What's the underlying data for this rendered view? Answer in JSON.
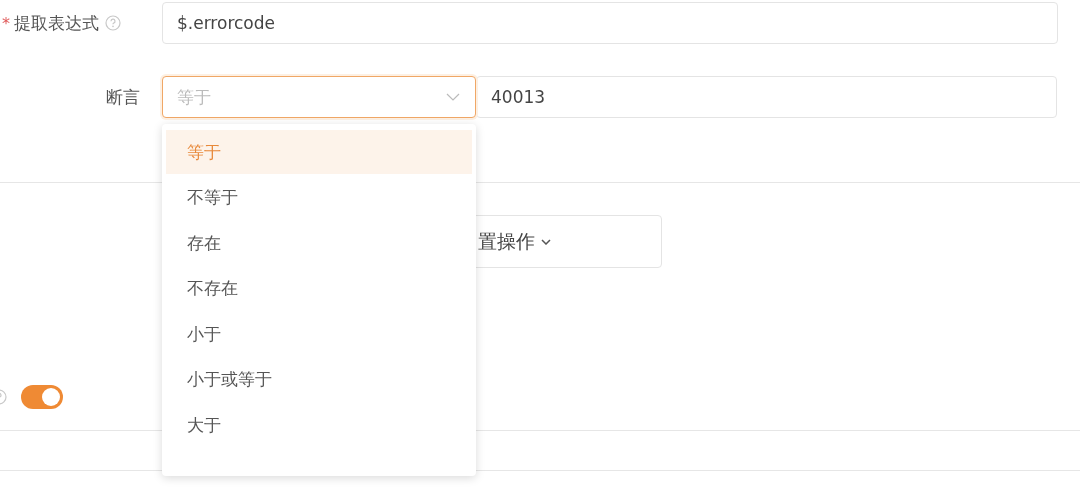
{
  "extract_field": {
    "required_mark": "*",
    "label": "提取表达式",
    "value": "$.errorcode"
  },
  "assert_field": {
    "label": "断言",
    "select": {
      "placeholder": "等于",
      "open": true
    },
    "value": "40013"
  },
  "dropdown": {
    "options": [
      {
        "label": "等于",
        "selected": true
      },
      {
        "label": "不等于",
        "selected": false
      },
      {
        "label": "存在",
        "selected": false
      },
      {
        "label": "不存在",
        "selected": false
      },
      {
        "label": "小于",
        "selected": false
      },
      {
        "label": "小于或等于",
        "selected": false
      },
      {
        "label": "大于",
        "selected": false
      }
    ]
  },
  "action_button": {
    "label": "置操作"
  },
  "toggle": {
    "on": true
  }
}
